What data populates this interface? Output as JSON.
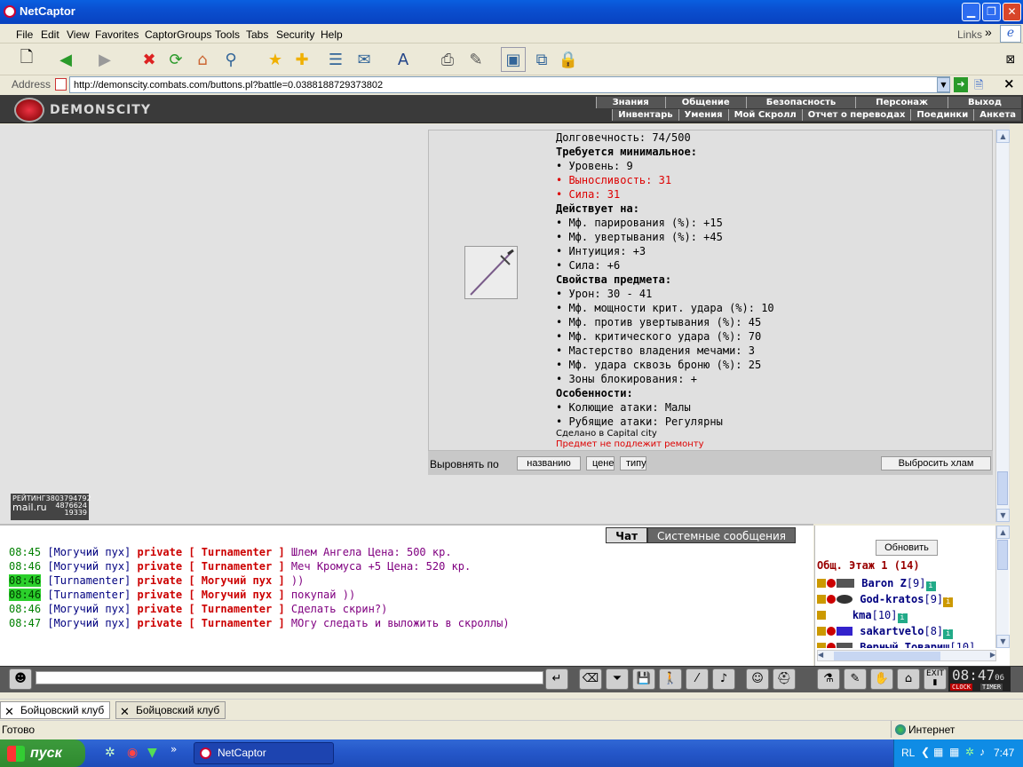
{
  "window": {
    "title": "NetCaptor",
    "minimize": "▁",
    "restore": "❐",
    "close": "✕"
  },
  "menu": {
    "items": [
      "File",
      "Edit",
      "View",
      "Favorites",
      "CaptorGroups",
      "Tools",
      "Tabs",
      "Security",
      "Help"
    ],
    "links": "Links"
  },
  "address": {
    "label": "Address",
    "url": "http://demonscity.combats.com/buttons.pl?battle=0.0388188729373802"
  },
  "game": {
    "logo": "DEMONSCITY",
    "nav_top": [
      "Знания",
      "Общение",
      "Безопасность",
      "Персонаж",
      "Выход"
    ],
    "nav_bottom": [
      "Инвентарь",
      "Умения",
      "Мой Скролл",
      "Отчет о переводах",
      "Поединки",
      "Анкета"
    ]
  },
  "item": {
    "durability": "Долговечность: 74/500",
    "req_header": "Требуется минимальное:",
    "req": [
      {
        "text": "• Уровень: 9",
        "red": false
      },
      {
        "text": "• Выносливость: 31",
        "red": true
      },
      {
        "text": "• Сила: 31",
        "red": true
      }
    ],
    "acts_header": "Действует на:",
    "acts": [
      "• Мф. парирования (%): +15",
      "• Мф. увертывания (%): +45",
      "• Интуиция: +3",
      "• Сила: +6"
    ],
    "props_header": "Свойства предмета:",
    "props": [
      "• Урон: 30 - 41",
      "• Мф. мощности крит. удара (%): 10",
      "• Мф. против увертывания (%): 45",
      "• Мф. критического удара (%): 70",
      "• Мастерство владения мечами: 3",
      "• Мф. удара сквозь броню (%): 25",
      "• Зоны блокирования: +"
    ],
    "features_header": "Особенности:",
    "features": [
      "• Колющие атаки: Малы",
      "• Рубящие атаки: Регулярны"
    ],
    "made_in": "Сделано в Capital city",
    "no_repair": "Предмет не подлежит ремонту"
  },
  "sort": {
    "label": "Выровнять по",
    "by_name": "названию",
    "by_price": "цене",
    "by_type": "типу",
    "drop_junk": "Выбросить хлам"
  },
  "rating": {
    "label": "РЕЙТИНГ",
    "n1": "3803794792",
    "brand": "mail.ru",
    "n2": "4876624",
    "n3": "19339"
  },
  "chat": {
    "tab_chat": "Чат",
    "tab_system": "Системные сообщения",
    "lines": [
      {
        "time": "08:45",
        "hl": false,
        "from": "[Могучий пух]",
        "priv": "private [ Turnamenter ]",
        "msg": "Шлем Ангела Цена: 500 кр."
      },
      {
        "time": "08:46",
        "hl": false,
        "from": "[Могучий пух]",
        "priv": "private [ Turnamenter ]",
        "msg": "Меч Кромуса +5 Цена: 520 кр."
      },
      {
        "time": "08:46",
        "hl": true,
        "from": "[Turnamenter]",
        "priv": "private [ Могучий пух ]",
        "msg": "))"
      },
      {
        "time": "08:46",
        "hl": true,
        "from": "[Turnamenter]",
        "priv": "private [ Могучий пух ]",
        "msg": "покупай ))"
      },
      {
        "time": "08:46",
        "hl": false,
        "from": "[Могучий пух]",
        "priv": "private [ Turnamenter ]",
        "msg": "Сделать скрин?)"
      },
      {
        "time": "08:47",
        "hl": false,
        "from": "[Могучий пух]",
        "priv": "private [ Turnamenter ]",
        "msg": "МОгу следать и выложить в скроллы)"
      }
    ]
  },
  "users": {
    "refresh": "Обновить",
    "floor": "Общ. Этаж 1 (14)",
    "list": [
      {
        "name": "Baron Z",
        "level": "[9]"
      },
      {
        "name": "God-kratos",
        "level": "[9]"
      },
      {
        "name": "kma",
        "level": "[10]"
      },
      {
        "name": "sakartvelo",
        "level": "[8]"
      },
      {
        "name": "Верный Товарищ",
        "level": "[10]"
      }
    ],
    "info": "i"
  },
  "clock": {
    "time": "08:47",
    "sec": "06",
    "clock_label": "CLOCK",
    "timer_label": "TIMER",
    "exit_label": "EXIT"
  },
  "tabs": [
    "Бойцовский клуб",
    "Бойцовский клуб"
  ],
  "status": {
    "text": "Готово",
    "zone": "Интернет"
  },
  "taskbar": {
    "start": "пуск",
    "task": "NetCaptor",
    "lang": "RL",
    "time": "7:47"
  },
  "colors": {
    "red_text": "#dd0000",
    "chat_time": "#008000",
    "chat_highlight": "#2bd02b",
    "chat_name": "#000080",
    "chat_private": "#cc0000",
    "chat_msg": "#800080"
  }
}
